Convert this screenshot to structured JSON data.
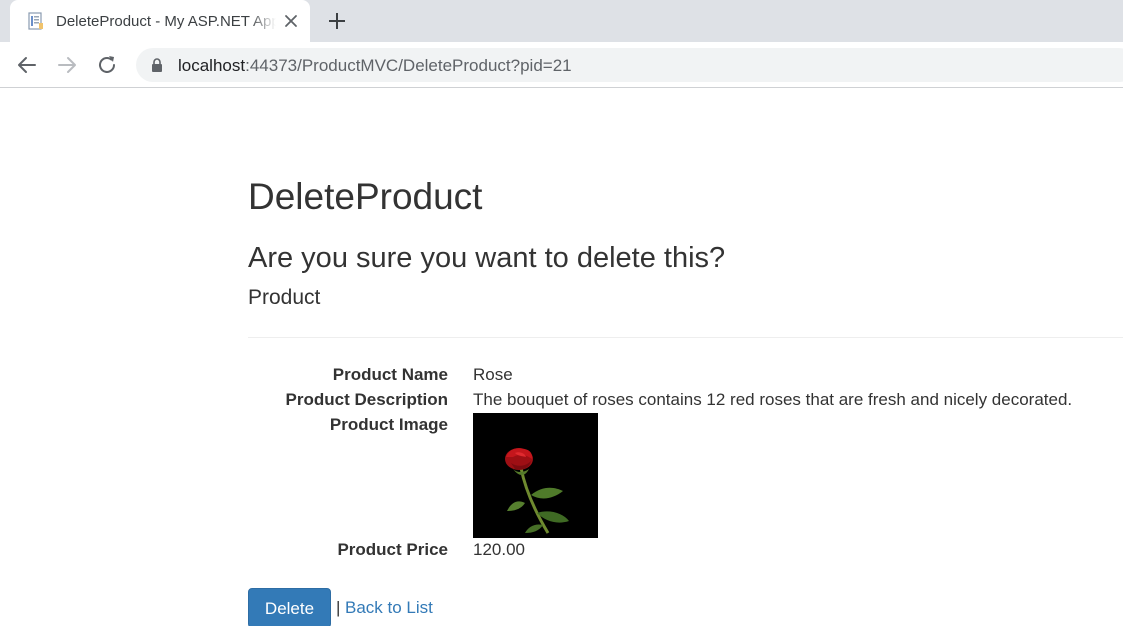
{
  "browser": {
    "tab_title": "DeleteProduct - My ASP.NET Application",
    "url_host": "localhost",
    "url_path": ":44373/ProductMVC/DeleteProduct?pid=21",
    "icons": [
      "page-favicon-icon",
      "close-icon",
      "plus-icon",
      "back-arrow-icon",
      "forward-arrow-icon",
      "reload-icon",
      "lock-icon"
    ]
  },
  "page": {
    "title": "DeleteProduct",
    "confirm_question": "Are you sure you want to delete this?",
    "entity_name": "Product",
    "fields": {
      "name_label": "Product Name",
      "name_value": "Rose",
      "description_label": "Product Description",
      "description_value": "The bouquet of roses contains 12 red roses that are fresh and nicely decorated.",
      "image_label": "Product Image",
      "price_label": "Product Price",
      "price_value": "120.00"
    },
    "actions": {
      "delete_label": "Delete",
      "separator": "|",
      "back_label": "Back to List"
    }
  },
  "colors": {
    "primary": "#337ab7",
    "text": "#333333",
    "tabstrip": "#dee1e6",
    "omnibox": "#f1f3f4"
  }
}
